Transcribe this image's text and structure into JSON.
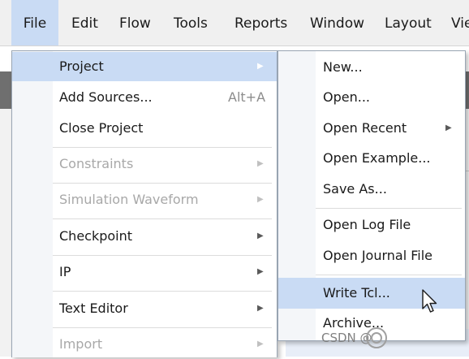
{
  "menubar": {
    "items": [
      {
        "name": "menu-file",
        "label": "File",
        "active": true
      },
      {
        "name": "menu-edit",
        "label": "Edit"
      },
      {
        "name": "menu-flow",
        "label": "Flow"
      },
      {
        "name": "menu-tools",
        "label": "Tools"
      },
      {
        "name": "menu-reports",
        "label": "Reports"
      },
      {
        "name": "menu-window",
        "label": "Window"
      },
      {
        "name": "menu-layout",
        "label": "Layout"
      },
      {
        "name": "menu-view",
        "label": "Vie"
      }
    ]
  },
  "file_menu": {
    "items": [
      {
        "label": "Project",
        "submenu": true,
        "highlighted": true
      },
      {
        "label": "Add Sources...",
        "accel": "Alt+A"
      },
      {
        "label": "Close Project"
      },
      {
        "label": "Constraints",
        "submenu": true,
        "disabled": true
      },
      {
        "label": "Simulation Waveform",
        "submenu": true,
        "disabled": true
      },
      {
        "label": "Checkpoint",
        "submenu": true
      },
      {
        "label": "IP",
        "submenu": true
      },
      {
        "label": "Text Editor",
        "submenu": true
      },
      {
        "label": "Import",
        "submenu": true,
        "disabled": true
      }
    ]
  },
  "project_menu": {
    "items": [
      {
        "label": "New..."
      },
      {
        "label": "Open..."
      },
      {
        "label": "Open Recent",
        "submenu": true
      },
      {
        "label": "Open Example..."
      },
      {
        "label": "Save As..."
      },
      {
        "label": "Open Log File"
      },
      {
        "label": "Open Journal File"
      },
      {
        "label": "Write Tcl...",
        "highlighted": true
      },
      {
        "label": "Archive..."
      }
    ]
  },
  "icons": {
    "submenu_arrow": "chevron-right-icon",
    "cursor": "mouse-pointer-icon"
  },
  "colors": {
    "highlight": "#c9dbf4",
    "menubar_bg": "#f0f0f0",
    "disabled_text": "#a8a8a8"
  },
  "watermark": {
    "text": "CSDN @"
  }
}
